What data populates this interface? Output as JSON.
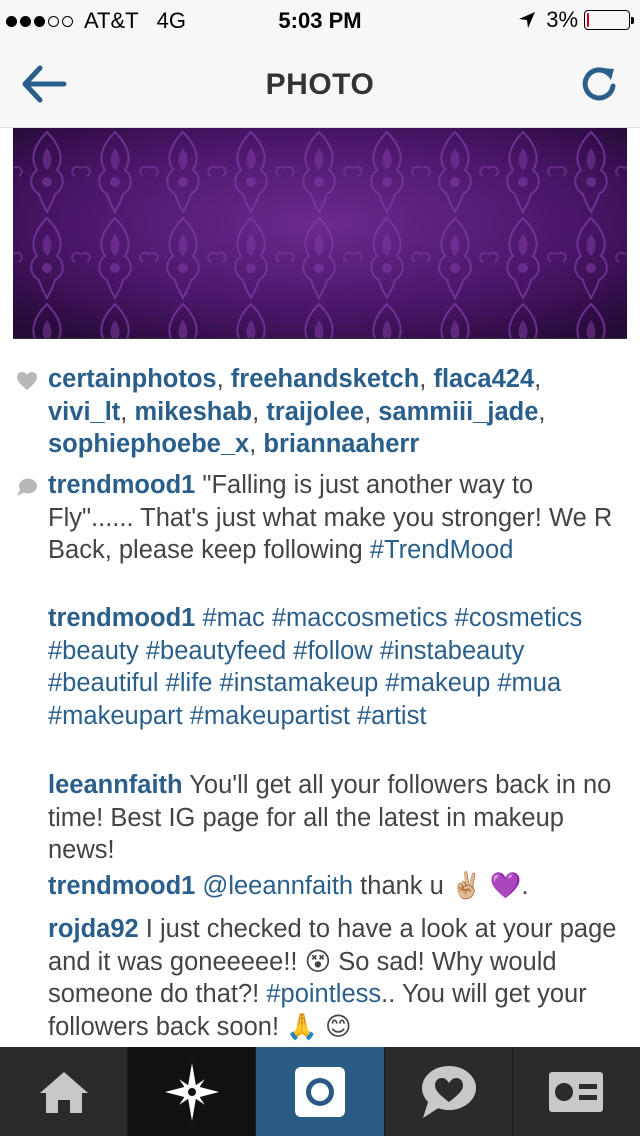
{
  "status_bar": {
    "carrier": "AT&T",
    "network": "4G",
    "time": "5:03 PM",
    "battery": "3%",
    "battery_level": 0.03,
    "signal_bars": 3
  },
  "nav": {
    "title": "PHOTO",
    "back_icon": "back-arrow-icon",
    "refresh_icon": "refresh-icon"
  },
  "colors": {
    "accent": "#2a5f8c",
    "text": "#444444",
    "photo_purple": "#4a1668",
    "tab_active": "#2a5a86"
  },
  "likes": {
    "icon": "heart-icon",
    "users": [
      "certainphotos",
      "freehandsketch",
      "flaca424",
      "vivi_lt",
      "mikeshab",
      "traijolee",
      "sammiii_jade",
      "sophiephoebe_x",
      "briannaaherr"
    ]
  },
  "comments": [
    {
      "user": "trendmood1",
      "text": " \"Falling is just another way to Fly\"...... That's just what make you stronger! We R Back, please keep following ",
      "tags": "#TrendMood"
    },
    {
      "user": "trendmood1",
      "text": " ",
      "tags": "#mac #maccosmetics #cosmetics #beauty #beautyfeed #follow #instabeauty #beautiful #life #instamakeup #makeup #mua #makeupart #makeupartist #artist"
    },
    {
      "user": "leeannfaith",
      "text": " You'll get all your followers back in no time! Best IG page for all the latest in makeup news!"
    },
    {
      "user": "trendmood1",
      "mention": " @leeannfaith",
      "text": " thank u ✌🏼 💜."
    },
    {
      "user": "rojda92",
      "text": " I just checked to have a look at your page and it was goneeeee!! 😵 So sad! Why would someone do that?! ",
      "tags": "#pointless",
      "text2": ".. You will get your followers back soon! 🙏 😊"
    }
  ],
  "tab_bar": [
    {
      "name": "home",
      "icon": "home-icon"
    },
    {
      "name": "explore",
      "icon": "explore-star-icon"
    },
    {
      "name": "camera",
      "icon": "camera-icon"
    },
    {
      "name": "activity",
      "icon": "activity-heart-icon"
    },
    {
      "name": "profile",
      "icon": "profile-card-icon"
    }
  ]
}
